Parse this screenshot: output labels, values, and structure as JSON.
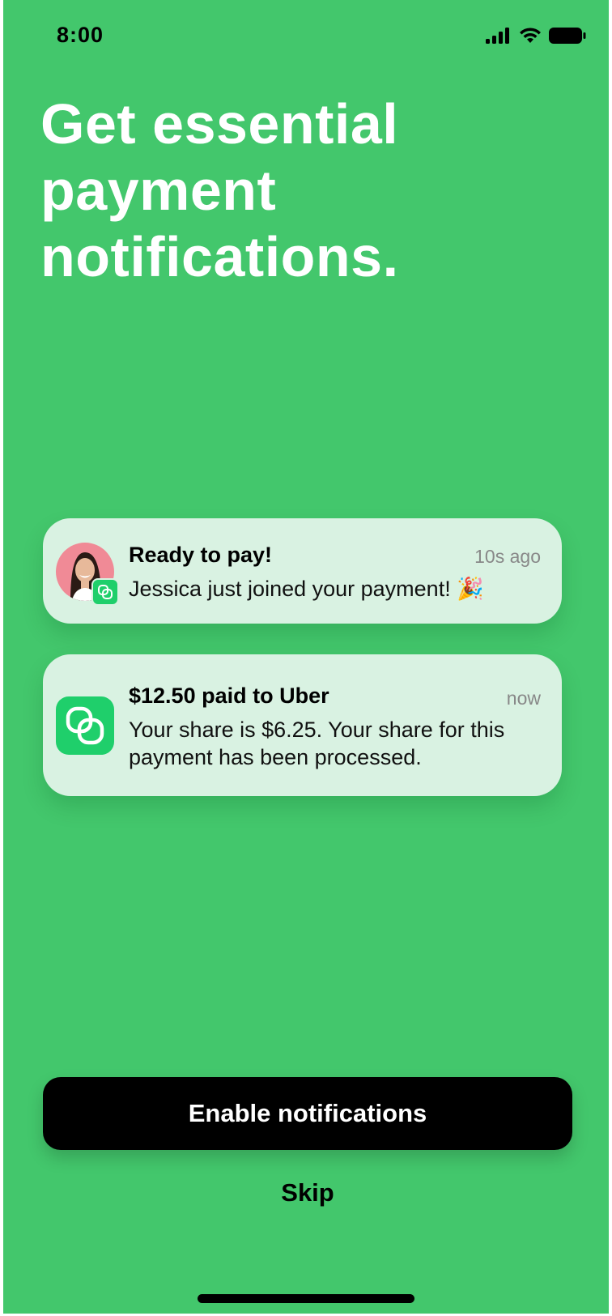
{
  "status_bar": {
    "time": "8:00",
    "icons": [
      "cellular-signal-icon",
      "wifi-icon",
      "battery-icon"
    ]
  },
  "headline": {
    "line1": "Get essential",
    "line2": "payment",
    "line3": "notifications."
  },
  "notifications": [
    {
      "title": "Ready to pay!",
      "time": "10s ago",
      "body": "Jessica just joined your payment! ",
      "emoji": "🎉",
      "icon": "user-avatar"
    },
    {
      "title": "$12.50 paid to Uber",
      "time": "now",
      "body": "Your share is $6.25. Your share for this payment has been processed.",
      "icon": "app-logo-icon"
    }
  ],
  "actions": {
    "enable_label": "Enable notifications",
    "skip_label": "Skip"
  },
  "colors": {
    "background": "#43c76c",
    "card": "#d9f2e2",
    "brand_green": "#1fcf6b",
    "button": "#000000"
  }
}
